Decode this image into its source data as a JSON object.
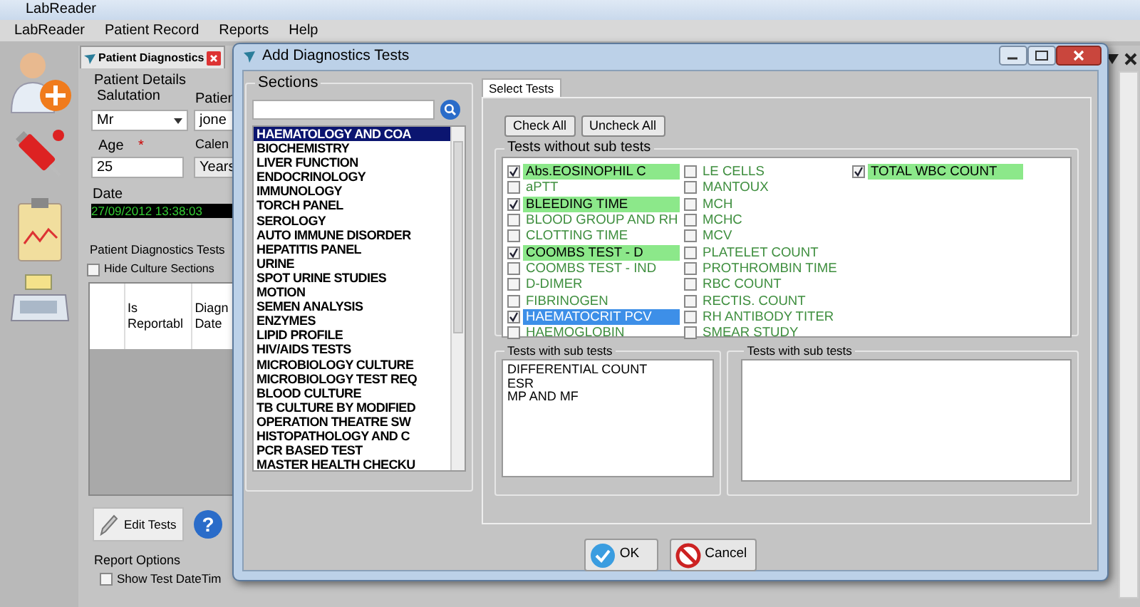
{
  "app": {
    "title": "LabReader",
    "menu": [
      "LabReader",
      "Patient Record",
      "Reports",
      "Help"
    ]
  },
  "patient_window": {
    "tab": "Patient Diagnostics",
    "details_title": "Patient Details",
    "salutation_label": "Salutation",
    "salutation": "Mr",
    "patient_label": "Patien",
    "patient_value": "jone",
    "age_label": "Age",
    "age_required_mark": "*",
    "age": "25",
    "calendar_label": "Calen",
    "age_unit": "Years",
    "date_label": "Date",
    "date": "27/09/2012 13:38:03",
    "tests_title": "Patient Diagnostics Tests",
    "hide_culture": {
      "label": "Hide Culture Sections",
      "checked": false
    },
    "columns": [
      "Is Reportabl",
      "Diagn Date"
    ],
    "edit_button": "Edit Tests",
    "help_button": "?",
    "report_options_title": "Report Options",
    "show_datetime": {
      "label": "Show Test DateTim",
      "checked": false
    }
  },
  "dialog": {
    "title": "Add Diagnostics Tests",
    "sections_title": "Sections",
    "sections": [
      {
        "label": "HAEMATOLOGY AND COA",
        "selected": true
      },
      {
        "label": "BIOCHEMISTRY",
        "selected": false
      },
      {
        "label": "LIVER FUNCTION",
        "selected": false
      },
      {
        "label": "ENDOCRINOLOGY",
        "selected": false
      },
      {
        "label": "IMMUNOLOGY",
        "selected": false
      },
      {
        "label": "TORCH PANEL",
        "selected": false
      },
      {
        "label": "SEROLOGY",
        "selected": false
      },
      {
        "label": "AUTO IMMUNE DISORDER",
        "selected": false
      },
      {
        "label": "HEPATITIS PANEL",
        "selected": false
      },
      {
        "label": "URINE",
        "selected": false
      },
      {
        "label": "SPOT URINE STUDIES",
        "selected": false
      },
      {
        "label": "MOTION",
        "selected": false
      },
      {
        "label": "SEMEN ANALYSIS",
        "selected": false
      },
      {
        "label": "ENZYMES",
        "selected": false
      },
      {
        "label": "LIPID PROFILE",
        "selected": false
      },
      {
        "label": "HIV/AIDS TESTS",
        "selected": false
      },
      {
        "label": "MICROBIOLOGY CULTURE",
        "selected": false
      },
      {
        "label": "MICROBIOLOGY TEST REQ",
        "selected": false
      },
      {
        "label": "BLOOD CULTURE",
        "selected": false
      },
      {
        "label": "TB CULTURE BY MODIFIED",
        "selected": false
      },
      {
        "label": "OPERATION THEATRE SW",
        "selected": false
      },
      {
        "label": "HISTOPATHOLOGY AND C",
        "selected": false
      },
      {
        "label": "PCR BASED TEST",
        "selected": false
      },
      {
        "label": "MASTER HEALTH CHECKU",
        "selected": false
      }
    ],
    "tabs": [
      {
        "label": "Select Tests",
        "selected": true
      }
    ],
    "check_all": "Check All",
    "uncheck_all": "Uncheck All",
    "without_sub_title": "Tests without sub tests",
    "tests": [
      {
        "label": "Abs.EOSINOPHIL C",
        "checked": true,
        "selected": false
      },
      {
        "label": "aPTT",
        "checked": false,
        "selected": false
      },
      {
        "label": "BLEEDING TIME",
        "checked": true,
        "selected": false
      },
      {
        "label": "BLOOD GROUP AND RH",
        "checked": false,
        "selected": false
      },
      {
        "label": "CLOTTING TIME",
        "checked": false,
        "selected": false
      },
      {
        "label": "COOMBS TEST - D",
        "checked": true,
        "selected": false
      },
      {
        "label": "COOMBS TEST - IND",
        "checked": false,
        "selected": false
      },
      {
        "label": "D-DIMER",
        "checked": false,
        "selected": false
      },
      {
        "label": "FIBRINOGEN",
        "checked": false,
        "selected": false
      },
      {
        "label": "HAEMATOCRIT PCV",
        "checked": true,
        "selected": true
      },
      {
        "label": "HAEMOGLOBIN",
        "checked": false,
        "selected": false
      },
      {
        "label": "LE CELLS",
        "checked": false,
        "selected": false
      },
      {
        "label": "MANTOUX",
        "checked": false,
        "selected": false
      },
      {
        "label": "MCH",
        "checked": false,
        "selected": false
      },
      {
        "label": "MCHC",
        "checked": false,
        "selected": false
      },
      {
        "label": "MCV",
        "checked": false,
        "selected": false
      },
      {
        "label": "PLATELET COUNT",
        "checked": false,
        "selected": false
      },
      {
        "label": "PROTHROMBIN TIME",
        "checked": false,
        "selected": false
      },
      {
        "label": "RBC COUNT",
        "checked": false,
        "selected": false
      },
      {
        "label": "RECTIS. COUNT",
        "checked": false,
        "selected": false
      },
      {
        "label": "RH ANTIBODY TITER",
        "checked": false,
        "selected": false
      },
      {
        "label": "SMEAR STUDY",
        "checked": false,
        "selected": false
      },
      {
        "label": "TOTAL WBC COUNT",
        "checked": true,
        "selected": false
      }
    ],
    "with_sub_left": {
      "title": "Tests with sub tests",
      "items": [
        "DIFFERENTIAL COUNT",
        "ESR",
        "MP AND MF"
      ]
    },
    "with_sub_right": {
      "title": "Tests with sub tests"
    },
    "ok": "OK",
    "cancel": "Cancel"
  }
}
